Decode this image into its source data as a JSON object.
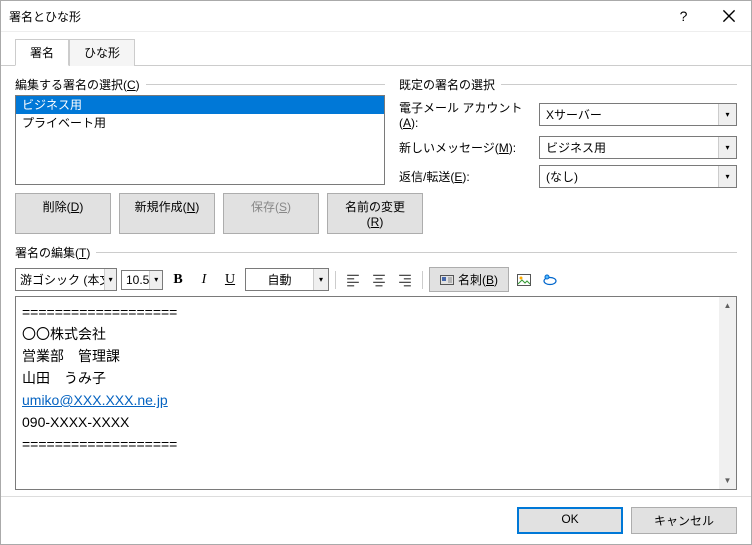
{
  "window": {
    "title": "署名とひな形"
  },
  "tabs": {
    "signature": "署名",
    "stationery": "ひな形"
  },
  "left": {
    "group": {
      "prefix": "編集する署名の選択(",
      "key": "C",
      "suffix": ")"
    },
    "items": [
      "ビジネス用",
      "プライベート用"
    ],
    "buttons": {
      "delete": {
        "prefix": "削除(",
        "key": "D",
        "suffix": ")"
      },
      "new": {
        "prefix": "新規作成(",
        "key": "N",
        "suffix": ")"
      },
      "save": {
        "prefix": "保存(",
        "key": "S",
        "suffix": ")"
      },
      "rename": {
        "prefix": "名前の変更(",
        "key": "R",
        "suffix": ")"
      }
    }
  },
  "right": {
    "group": "既定の署名の選択",
    "account": {
      "prefix": "電子メール アカウント(",
      "key": "A",
      "suffix": "):",
      "value": "Xサーバー"
    },
    "newmsg": {
      "prefix": "新しいメッセージ(",
      "key": "M",
      "suffix": "):",
      "value": "ビジネス用"
    },
    "reply": {
      "prefix": "返信/転送(",
      "key": "E",
      "suffix": "):",
      "value": "(なし)"
    }
  },
  "editor": {
    "group": {
      "prefix": "署名の編集(",
      "key": "T",
      "suffix": ")"
    },
    "font": "游ゴシック (本文の",
    "size": "10.5",
    "color": "自動",
    "bcard": {
      "prefix": "名刺(",
      "key": "B",
      "suffix": ")"
    },
    "lines": {
      "sep": "===================",
      "l1": "〇〇株式会社",
      "l2": "営業部　管理課",
      "l3": "山田　うみ子",
      "email": "umiko@XXX.XXX.ne.jp",
      "tel": "090-XXXX-XXXX",
      "sep2": "==================="
    }
  },
  "footer": {
    "ok": "OK",
    "cancel": "キャンセル"
  }
}
